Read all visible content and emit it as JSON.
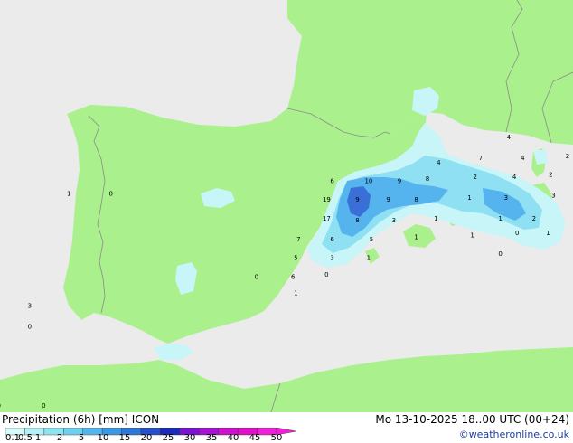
{
  "map": {
    "precip_labels": [
      {
        "text": "1",
        "lon": 5.45,
        "lat": 46.3
      },
      {
        "text": "0",
        "lon": 6.0,
        "lat": 46.35
      },
      {
        "text": "4",
        "lon": 2.95,
        "lat": 42.3
      },
      {
        "text": "4",
        "lon": 1.7,
        "lat": 41.7
      },
      {
        "text": "7",
        "lon": 2.45,
        "lat": 41.8
      },
      {
        "text": "4",
        "lon": 3.2,
        "lat": 41.8
      },
      {
        "text": "2",
        "lon": 4.0,
        "lat": 41.85
      },
      {
        "text": "6",
        "lon": -0.2,
        "lat": 41.25
      },
      {
        "text": "10",
        "lon": 0.45,
        "lat": 41.25
      },
      {
        "text": "9",
        "lon": 1.0,
        "lat": 41.25
      },
      {
        "text": "8",
        "lon": 1.5,
        "lat": 41.3
      },
      {
        "text": "2",
        "lon": 2.35,
        "lat": 41.35
      },
      {
        "text": "4",
        "lon": 3.05,
        "lat": 41.35
      },
      {
        "text": "2",
        "lon": 3.7,
        "lat": 41.4
      },
      {
        "text": "1",
        "lon": 4.4,
        "lat": 41.4
      },
      {
        "text": "1",
        "lon": 5.1,
        "lat": 41.45
      },
      {
        "text": "19",
        "lon": -0.3,
        "lat": 40.8
      },
      {
        "text": "9",
        "lon": 0.25,
        "lat": 40.8
      },
      {
        "text": "9",
        "lon": 0.8,
        "lat": 40.8
      },
      {
        "text": "8",
        "lon": 1.3,
        "lat": 40.8
      },
      {
        "text": "1",
        "lon": 2.25,
        "lat": 40.85
      },
      {
        "text": "3",
        "lon": 2.9,
        "lat": 40.85
      },
      {
        "text": "3",
        "lon": 3.75,
        "lat": 40.9
      },
      {
        "text": "2",
        "lon": 4.55,
        "lat": 40.9
      },
      {
        "text": "0",
        "lon": 5.4,
        "lat": 41.0
      },
      {
        "text": "17",
        "lon": -0.3,
        "lat": 40.35
      },
      {
        "text": "8",
        "lon": 0.25,
        "lat": 40.3
      },
      {
        "text": "3",
        "lon": 0.9,
        "lat": 40.3
      },
      {
        "text": "1",
        "lon": 1.65,
        "lat": 40.35
      },
      {
        "text": "1",
        "lon": 2.8,
        "lat": 40.35
      },
      {
        "text": "2",
        "lon": 3.4,
        "lat": 40.35
      },
      {
        "text": "2",
        "lon": 4.15,
        "lat": 40.4
      },
      {
        "text": "4",
        "lon": 4.9,
        "lat": 40.4
      },
      {
        "text": "7",
        "lon": -0.8,
        "lat": 39.85
      },
      {
        "text": "6",
        "lon": -0.2,
        "lat": 39.85
      },
      {
        "text": "5",
        "lon": 0.5,
        "lat": 39.85
      },
      {
        "text": "1",
        "lon": 1.3,
        "lat": 39.9
      },
      {
        "text": "1",
        "lon": 2.3,
        "lat": 39.95
      },
      {
        "text": "0",
        "lon": 3.1,
        "lat": 40.0
      },
      {
        "text": "1",
        "lon": 3.65,
        "lat": 40.0
      },
      {
        "text": "2",
        "lon": 4.3,
        "lat": 40.0
      },
      {
        "text": "2",
        "lon": 5.9,
        "lat": 40.1
      },
      {
        "text": "5",
        "lon": -0.85,
        "lat": 39.4
      },
      {
        "text": "3",
        "lon": -0.2,
        "lat": 39.4
      },
      {
        "text": "1",
        "lon": 0.45,
        "lat": 39.4
      },
      {
        "text": "0",
        "lon": 2.8,
        "lat": 39.5
      },
      {
        "text": "0",
        "lon": 4.3,
        "lat": 39.55
      },
      {
        "text": "1",
        "lon": 4.9,
        "lat": 39.55
      },
      {
        "text": "2",
        "lon": 5.5,
        "lat": 39.6
      },
      {
        "text": "1",
        "lon": 6.2,
        "lat": 39.65
      },
      {
        "text": "0",
        "lon": -1.55,
        "lat": 38.95
      },
      {
        "text": "6",
        "lon": -0.9,
        "lat": 38.95
      },
      {
        "text": "0",
        "lon": -0.3,
        "lat": 39.0
      },
      {
        "text": "1",
        "lon": 5.2,
        "lat": 39.25
      },
      {
        "text": "3",
        "lon": 5.85,
        "lat": 39.25
      },
      {
        "text": "1",
        "lon": 6.9,
        "lat": 39.25
      },
      {
        "text": "1",
        "lon": -0.85,
        "lat": 38.55
      },
      {
        "text": "1",
        "lon": -4.9,
        "lat": 40.95
      },
      {
        "text": "0",
        "lon": -4.15,
        "lat": 40.95
      },
      {
        "text": "0",
        "lon": -7.2,
        "lat": 39.15
      },
      {
        "text": "3",
        "lon": -5.6,
        "lat": 38.25
      },
      {
        "text": "0",
        "lon": -5.6,
        "lat": 37.75
      },
      {
        "text": "0",
        "lon": -6.15,
        "lat": 35.85
      },
      {
        "text": "0",
        "lon": -5.35,
        "lat": 35.85
      }
    ]
  },
  "footer": {
    "title": "Precipitation (6h) [mm] ICON",
    "datetime": "Mo 13-10-2025 18..00 UTC (00+24)",
    "credit": "©weatheronline.co.uk"
  },
  "legend": {
    "ticks": [
      "0.1",
      "0.5",
      "1",
      "2",
      "5",
      "10",
      "15",
      "20",
      "25",
      "30",
      "35",
      "40",
      "45",
      "50"
    ],
    "colors": [
      "#d6fafa",
      "#b4f0f5",
      "#8ee3f0",
      "#6ed0ee",
      "#52b6ea",
      "#3c98e0",
      "#2f78d6",
      "#2550c8",
      "#1c2bb8",
      "#7a14d0",
      "#a414d2",
      "#cc10cc",
      "#e010c8",
      "#f020d8"
    ]
  },
  "colors": {
    "land": "#aaf08c",
    "sea": "#ebebeb",
    "border": "#8c8c8c",
    "precip_light": "#c8f5f8",
    "precip_mid": "#8fe0f2",
    "precip_heavy": "#55b4ee",
    "precip_max": "#3a6fd8"
  }
}
